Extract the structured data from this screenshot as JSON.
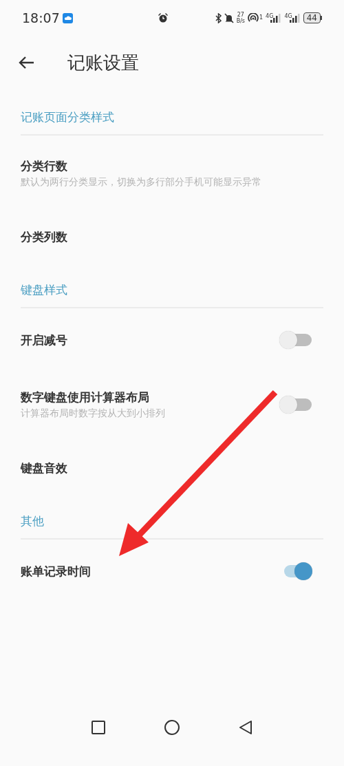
{
  "status_bar": {
    "time": "18:07",
    "net_speed_value": "27",
    "net_speed_unit": "B/s",
    "hotspot_count": "1",
    "sim_1": "4G",
    "sim_2": "4G",
    "battery": "44"
  },
  "header": {
    "title": "记账设置"
  },
  "sections": [
    {
      "title": "记账页面分类样式",
      "items": [
        {
          "kind": "plain",
          "title": "分类行数",
          "subtitle": "默认为两行分类显示，切换为多行部分手机可能显示异常"
        },
        {
          "kind": "plain",
          "title": "分类列数"
        }
      ]
    },
    {
      "title": "键盘样式",
      "items": [
        {
          "kind": "toggle",
          "title": "开启减号",
          "on": false
        },
        {
          "kind": "toggle",
          "title": "数字键盘使用计算器布局",
          "subtitle": "计算器布局时数字按从大到小排列",
          "on": false
        },
        {
          "kind": "plain",
          "title": "键盘音效"
        }
      ]
    },
    {
      "title": "其他",
      "items": [
        {
          "kind": "toggle",
          "title": "账单记录时间",
          "on": true
        }
      ]
    }
  ],
  "annotation": {
    "kind": "arrow"
  }
}
